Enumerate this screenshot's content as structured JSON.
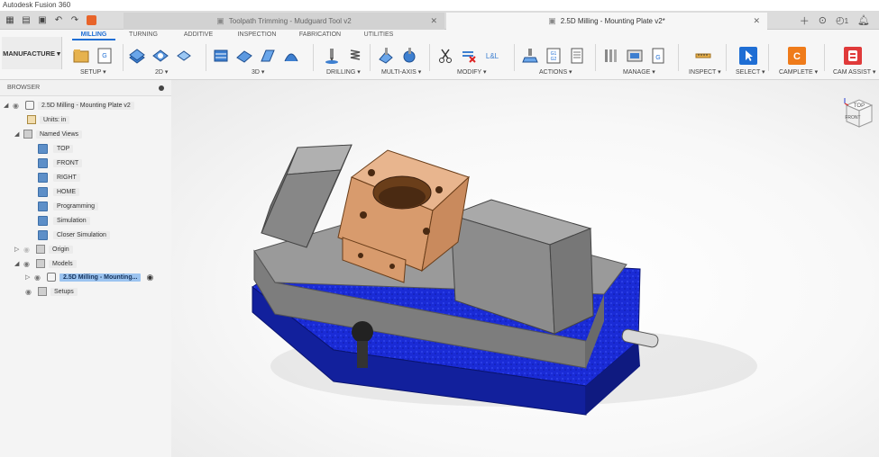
{
  "app_title": "Autodesk Fusion 360",
  "tabs": {
    "inactive": "Toolpath Trimming - Mudguard Tool v2",
    "active": "2.5D Milling - Mounting Plate v2*"
  },
  "header_badge": "1",
  "workspace": "MANUFACTURE ▾",
  "ribbon_tabs": [
    "MILLING",
    "TURNING",
    "ADDITIVE",
    "INSPECTION",
    "FABRICATION",
    "UTILITIES"
  ],
  "groups": {
    "setup": "SETUP ▾",
    "twod": "2D ▾",
    "threed": "3D ▾",
    "drilling": "DRILLING ▾",
    "multiaxis": "MULTI-AXIS ▾",
    "modify": "MODIFY ▾",
    "actions": "ACTIONS ▾",
    "manage": "MANAGE ▾",
    "inspect": "INSPECT ▾",
    "select": "SELECT ▾",
    "camplete": "CAMPLETE ▾",
    "camassist": "CAM ASSIST ▾"
  },
  "browser": {
    "title": "BROWSER",
    "root": "2.5D Milling - Mounting Plate v2",
    "units": "Units: in",
    "named_views": "Named Views",
    "views": [
      "TOP",
      "FRONT",
      "RIGHT",
      "HOME",
      "Programming",
      "Simulation",
      "Closer Simulation"
    ],
    "origin": "Origin",
    "models": "Models",
    "model_item": "2.5D Milling - Mounting...",
    "setups": "Setups"
  },
  "viewcube": {
    "top": "TOP",
    "front": "FRONT"
  },
  "colors": {
    "accent": "#1f6ed4",
    "vise_base": "#1a2bd6",
    "part": "#e8b58e",
    "jaw": "#8f8f8f"
  }
}
